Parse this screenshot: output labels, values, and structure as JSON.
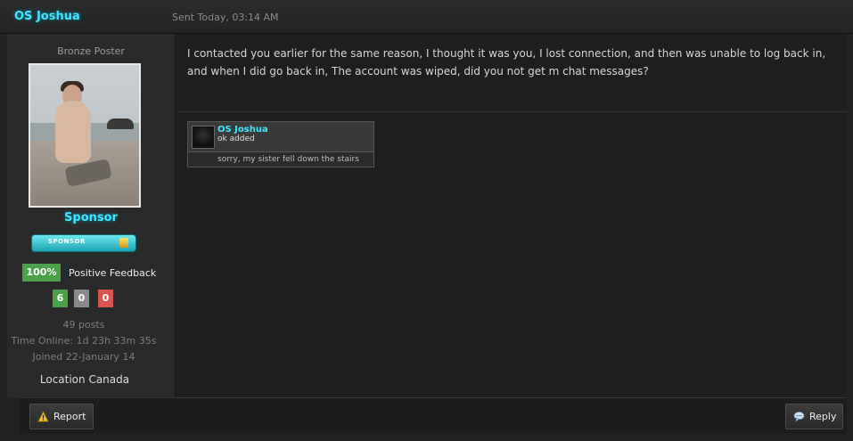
{
  "post": {
    "author": "OS Joshua",
    "sent": "Sent Today, 03:14 AM"
  },
  "sidebar": {
    "rank": "Bronze Poster",
    "group": "Sponsor",
    "sponsor_badge": "SPONSOR",
    "feedback_percent": "100%",
    "feedback_label": "Positive Feedback",
    "feedback_counts": {
      "positive": "6",
      "neutral": "0",
      "negative": "0"
    },
    "posts": "49 posts",
    "time_online": "Time Online: 1d 23h 33m 35s",
    "joined": "Joined 22-January 14",
    "location": "Location Canada"
  },
  "message": {
    "body": "I contacted you earlier for the same reason, I thought it was you, I lost connection, and then was unable to log back in, and when I did go back in, The account was wiped, did you not get m chat messages?"
  },
  "shout": {
    "name": "OS Joshua",
    "line1": "ok added",
    "line2": "sorry, my sister fell down the stairs"
  },
  "footer": {
    "report_label": "Report",
    "reply_label": "Reply"
  },
  "colors": {
    "username": "#3fe6ff",
    "feedback_positive": "#4aa14a",
    "feedback_neutral": "#8a8a8a",
    "feedback_negative": "#d9534f"
  }
}
